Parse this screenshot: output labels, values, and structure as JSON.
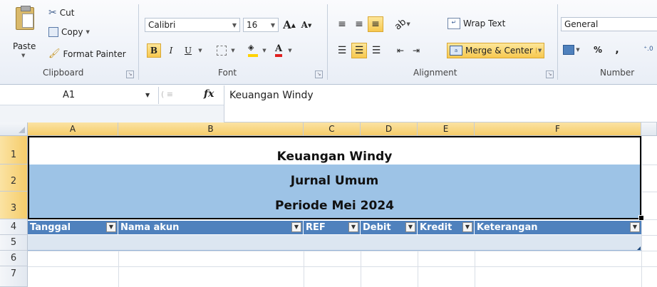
{
  "ribbon": {
    "clipboard": {
      "paste": "Paste",
      "cut": "Cut",
      "copy": "Copy",
      "format_painter": "Format Painter",
      "label": "Clipboard"
    },
    "font": {
      "name": "Calibri",
      "size": "16",
      "label": "Font",
      "bold": "B",
      "italic": "I",
      "underline": "U",
      "grow": "A",
      "shrink": "A"
    },
    "alignment": {
      "wrap_text": "Wrap Text",
      "merge_center": "Merge & Center",
      "label": "Alignment"
    },
    "number": {
      "format": "General",
      "percent": "%",
      "comma": ",",
      "label": "Number"
    }
  },
  "formula_bar": {
    "name_box": "A1",
    "fx": "fx",
    "content": "Keuangan Windy"
  },
  "columns": [
    "A",
    "B",
    "C",
    "D",
    "E",
    "F"
  ],
  "rows": [
    "1",
    "2",
    "3",
    "4",
    "5",
    "6",
    "7"
  ],
  "banner": {
    "title": "Keuangan Windy",
    "subtitle": "Jurnal Umum",
    "period": "Periode Mei 2024"
  },
  "table": {
    "headers": [
      "Tanggal",
      "Nama akun",
      "REF",
      "Debit",
      "Kredit",
      "Keterangan"
    ]
  },
  "colors": {
    "header_blue": "#4f81bd",
    "banner_light_blue": "#9dc3e6",
    "selected_header": "#f5cc6a"
  }
}
